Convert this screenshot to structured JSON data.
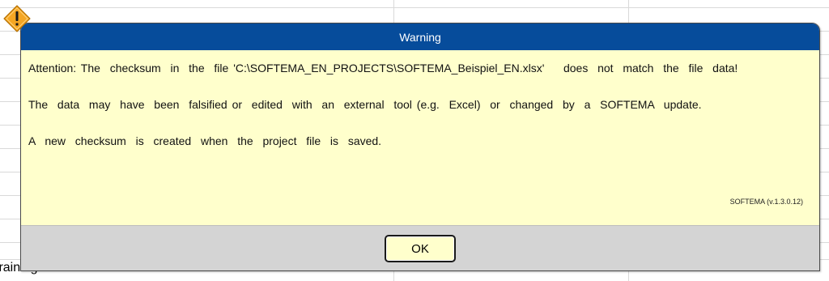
{
  "background": {
    "cell_text": "training"
  },
  "dialog": {
    "title": "Warning",
    "icon": "warning-diamond-icon",
    "messages": [
      "Attention: The  checksum  in  the  file 'C:\\SOFTEMA_EN_PROJECTS\\SOFTEMA_Beispiel_EN.xlsx'    does  not  match  the  file  data!",
      "The  data  may  have  been  falsified or  edited  with  an  external  tool (e.g.  Excel)  or  changed  by  a  SOFTEMA  update.",
      "A  new  checksum  is  created  when  the  project  file  is  saved."
    ],
    "version": "SOFTEMA  (v.1.3.0.12)",
    "ok_label": "OK"
  },
  "colors": {
    "header": "#064c9b",
    "body": "#ffffcc",
    "footer": "#d4d4d4",
    "icon": "#f5a623"
  }
}
